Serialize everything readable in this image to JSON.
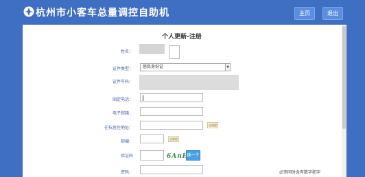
{
  "header": {
    "title": "杭州市小客车总量调控自助机",
    "home_label": "主页",
    "exit_label": "退出"
  },
  "form": {
    "title": "个人更新-注册",
    "name_label": "姓名：",
    "id_type_label": "证件类型：",
    "id_type_value": "居民身份证",
    "id_number_label": "证件号码：",
    "phone_label": "固定电话：",
    "email_label": "电子邮箱：",
    "address_label": "在杭居住地址：",
    "postcode_label": "邮编：",
    "captcha_label": "验证码",
    "captcha_text": "6AnH",
    "refresh_label": "换一个",
    "password_label": "密码：",
    "password_hint": "必须同时含有数字和字",
    "button_label": "全键盘"
  },
  "colors": {
    "header_bg": "#3f6fc2",
    "button_bg": "#5b8ee0",
    "label_color": "#4a66a8",
    "refresh_bg": "#49a2e6"
  }
}
